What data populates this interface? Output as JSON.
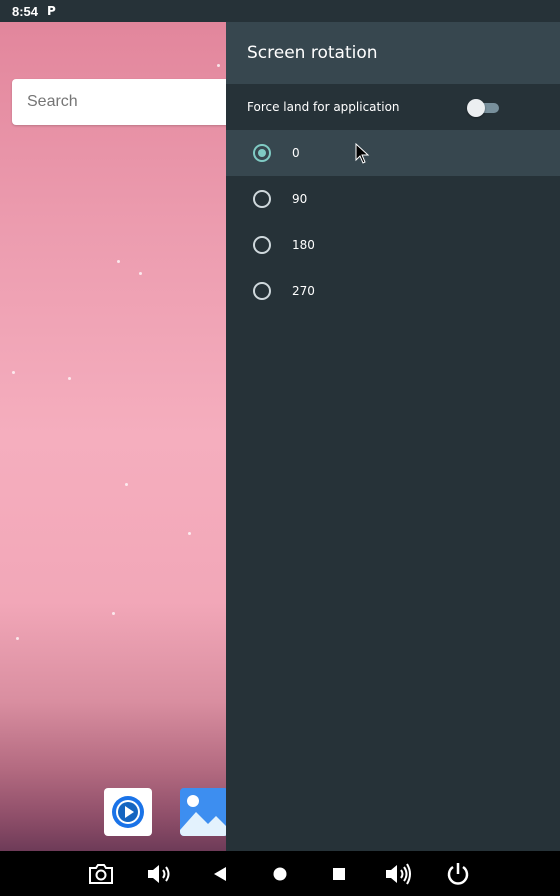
{
  "status_bar": {
    "time": "8:54",
    "notification_icon": "p-icon"
  },
  "launcher": {
    "search_placeholder": "Search",
    "dock": [
      {
        "icon": "video-player-app-icon"
      },
      {
        "icon": "gallery-app-icon"
      }
    ]
  },
  "panel": {
    "title": "Screen rotation",
    "force_land_label": "Force land for application",
    "force_land_enabled": false,
    "options": [
      {
        "label": "0",
        "selected": true
      },
      {
        "label": "90",
        "selected": false
      },
      {
        "label": "180",
        "selected": false
      },
      {
        "label": "270",
        "selected": false
      }
    ]
  },
  "nav_bar": {
    "buttons": [
      "camera-icon",
      "volume-down-icon",
      "back-icon",
      "home-icon",
      "recents-icon",
      "volume-up-icon",
      "power-icon"
    ]
  },
  "colors": {
    "panel_bg": "#263238",
    "header_bg": "#37474f",
    "accent": "#80cbc4"
  }
}
